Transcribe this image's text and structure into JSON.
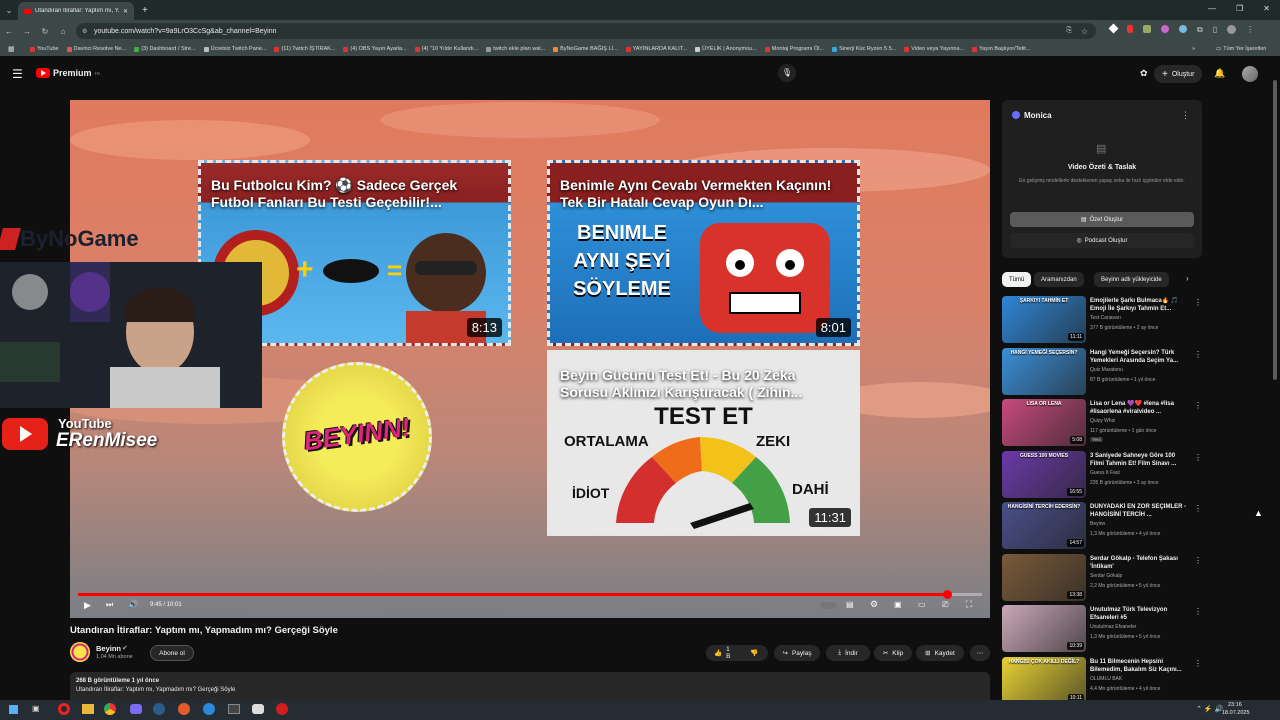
{
  "browser": {
    "tab_title": "Utandıran İtiraflar: Yaptım mı, Y...",
    "new_tab": "+",
    "url": "youtube.com/watch?v=9a9LrO3CcSg&ab_channel=Beyinn",
    "bookmarks": [
      "YouTube",
      "Davinci Resolve Ne...",
      "(3) Dashboard / Stre...",
      "Ücretsiz Twitch Pane...",
      "(11) Twitch İŞTİRAK...",
      "(4) OBS Yayın Ayarla...",
      "(4) \"10 Yıldır Kullandı...",
      "twitch ekle plan wal...",
      "ByNoGame BAĞIŞ Lİ...",
      "YAYINLARDA KALIT...",
      "ÜYELİK | Anonymou...",
      "Montaj Programı Öl...",
      "Sinerji Küc Ryzen 5 5...",
      "Video veya Yayınna...",
      "Yayın Başlıyor/Tetit..."
    ],
    "all_bookmarks": "Tüm Yer İşaretleri"
  },
  "header": {
    "logo_text": "Premium",
    "logo_sup": "TR",
    "search_value": "omu bumu",
    "create_label": "Oluştur"
  },
  "video": {
    "thumbs": [
      {
        "title": "Bu Futbolcu Kim? ⚽ Sadece Gerçek Futbol Fanları Bu Testi Geçebilir!...",
        "duration": "8:13"
      },
      {
        "title": "Benimle Aynı Cevabı Vermekten Kaçının! Tek Bir Hatalı Cevap Oyun Dı...",
        "duration": "8:01",
        "art": "BENIMLE AYNI ŞEYİ SÖYLEME"
      },
      {
        "title": "Beyin Gücünü Test Et! - Bu 20 Zeka Sorusu Aklınızı Karıştıracak ( Zihin...",
        "duration": "11:31",
        "art_title": "TEST ET",
        "art_labels": [
          "ORTALAMA",
          "ZEKI",
          "İDİOT",
          "DAHİ"
        ]
      }
    ],
    "logo_text": "BEYINN!",
    "time": "9:45 / 10:01",
    "progress": 0.961
  },
  "overlay": {
    "brand": "ByNoGame",
    "yt_label": "YouTube",
    "yt_name": "ERenMisee"
  },
  "below": {
    "title": "Utandıran İtiraflar: Yaptım mı, Yapmadım mı? Gerçeği Söyle",
    "channel_name": "Beyinn",
    "subscribers": "1,04 Mn abone",
    "subscribe": "Abone ol",
    "likes": "1 B",
    "share": "Paylaş",
    "download": "İndir",
    "clip": "Klip",
    "save": "Kaydet",
    "desc_line1": "268 B görüntüleme  1 yıl önce",
    "desc_line2": "Utandıran İtiraflar: Yaptım mı, Yapmadım mı? Gerçeği Söyle"
  },
  "monica": {
    "title": "Monica",
    "heading": "Video Özeti & Taslak",
    "subtext": "En gelişmiş modellerle desteklenen yapay zeka ile hızlı içgörüler elde edin.",
    "summary_btn": "Özet Oluştur",
    "podcast_btn": "Podcast Oluştur"
  },
  "chips": [
    "Tümü",
    "Aramanızdan",
    "Beyinn adlı yükleyicide"
  ],
  "recs": [
    {
      "title": "Emojilerle Şarkı Bulmaca🔥 🎵 Emoji İle Şarkıyı Tahmin Et...",
      "channel": "Test Canavarı",
      "meta": "377 B görüntüleme • 2 ay önce",
      "duration": "11:11",
      "color": "#2f86d6",
      "label": "ŞARKIYI TAHMİN ET"
    },
    {
      "title": "Hangi Yemeği Seçersin? Türk Yemekleri Arasında Seçim Ya...",
      "channel": "Quiz Maratonu",
      "meta": "87 B görüntüleme • 1 yıl önce",
      "duration": "",
      "color": "#3b8fd8",
      "label": "HANGİ YEMEĞİ SEÇERSİN?"
    },
    {
      "title": "Lisa or Lena 💜❤️ #lena #lisa #lisaorlena #viralvideo ...",
      "channel": "Quizy Whiz",
      "meta": "117 görüntüleme • 1 gün önce",
      "duration": "5:08",
      "color": "#c74a7c",
      "label": "LISA OR LENA",
      "badge": "Yeni"
    },
    {
      "title": "3 Saniyede Sahneye Göre 100 Filmi Tahmin Et! Film Sinavı ...",
      "channel": "Guess It Fast",
      "meta": "235 B görüntüleme • 3 ay önce",
      "duration": "16:55",
      "color": "#6b3aa8",
      "label": "GUESS 100 MOVIES"
    },
    {
      "title": "DÜNYADAKİ EN ZOR SEÇİMLER - HANGİSİNİ TERCİH ...",
      "channel": "Beyinn",
      "meta": "1,3 Mn görüntüleme • 4 yıl önce",
      "duration": "14:57",
      "color": "#4a4f8a",
      "label": "HANGİSİNİ TERCİH EDERSİN?"
    },
    {
      "title": "Serdar Gökalp - Telefon Şakası 'İntikam'",
      "channel": "Serdar Gökalp",
      "meta": "2,2 Mn görüntüleme • 5 yıl önce",
      "duration": "13:38",
      "color": "#7a5a3a",
      "label": ""
    },
    {
      "title": "Unutulmaz Türk Televizyon Efsaneleri #5",
      "channel": "Unutulmaz Efsaneler",
      "meta": "1,3 Mn görüntüleme • 5 yıl önce",
      "duration": "10:39",
      "color": "#caa7b8",
      "label": ""
    },
    {
      "title": "Bu 11 Bilmecenin Hepsini Bilemedim, Bakalım Siz Kaçını...",
      "channel": "OLUMLU BAK",
      "meta": "4,4 Mn görüntüleme • 4 yıl önce",
      "duration": "10:11",
      "color": "#e8d234",
      "label": "HANGİSİ ÇOK AKILLI DEĞİL?"
    }
  ],
  "taskbar": {
    "time": "23:16",
    "date": "18.07.2025"
  }
}
